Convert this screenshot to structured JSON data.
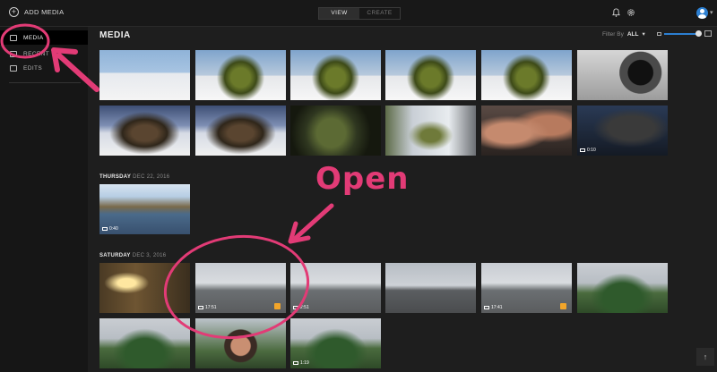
{
  "header": {
    "add_media_label": "ADD MEDIA",
    "view_label": "VIEW",
    "create_label": "CREATE"
  },
  "sidebar": {
    "items": [
      {
        "label": "MEDIA",
        "active": true
      },
      {
        "label": "RECENT",
        "active": false
      },
      {
        "label": "EDITS",
        "active": false
      }
    ]
  },
  "main": {
    "title": "MEDIA",
    "filter_label": "Filter By",
    "filter_value": "ALL"
  },
  "sections": [
    {
      "weekday": "THURSDAY",
      "date": "DEC 22, 2016"
    },
    {
      "weekday": "SATURDAY",
      "date": "DEC 3, 2016"
    }
  ],
  "thumbs": {
    "row1": [
      {
        "scene": "dead-plant"
      },
      {
        "scene": "plant"
      },
      {
        "scene": "plant"
      },
      {
        "scene": "plant"
      },
      {
        "scene": "plant"
      },
      {
        "scene": "device"
      }
    ],
    "row2": [
      {
        "scene": "dead-plant"
      },
      {
        "scene": "dead-plant"
      },
      {
        "scene": "moss"
      },
      {
        "scene": "sapling"
      },
      {
        "scene": "hands"
      },
      {
        "scene": "screen",
        "video": true,
        "duration": "0:10"
      }
    ],
    "thursday": [
      {
        "scene": "river",
        "video": true,
        "duration": "0:40"
      }
    ],
    "saturday_row1": [
      {
        "scene": "indoor"
      },
      {
        "scene": "road",
        "video": true,
        "duration": "17:51",
        "favorite": true
      },
      {
        "scene": "road",
        "video": true,
        "duration": "2:51"
      },
      {
        "scene": "road-dash"
      },
      {
        "scene": "road",
        "video": true,
        "duration": "17:41",
        "favorite": true
      },
      {
        "scene": "trees"
      }
    ],
    "saturday_row2": [
      {
        "scene": "trees"
      },
      {
        "scene": "selfie"
      },
      {
        "scene": "trees",
        "video": true,
        "duration": "1:19"
      }
    ]
  },
  "annotation": {
    "open_text": "Open",
    "color": "#e23b76"
  },
  "colors": {
    "accent": "#2c7fd1",
    "favorite": "#f2a52a",
    "background": "#1e1e1e"
  },
  "icons": {
    "add": "plus-circle-icon",
    "notifications": "bell-icon",
    "settings": "gear-icon",
    "scroll_top": "arrow-up-icon"
  }
}
